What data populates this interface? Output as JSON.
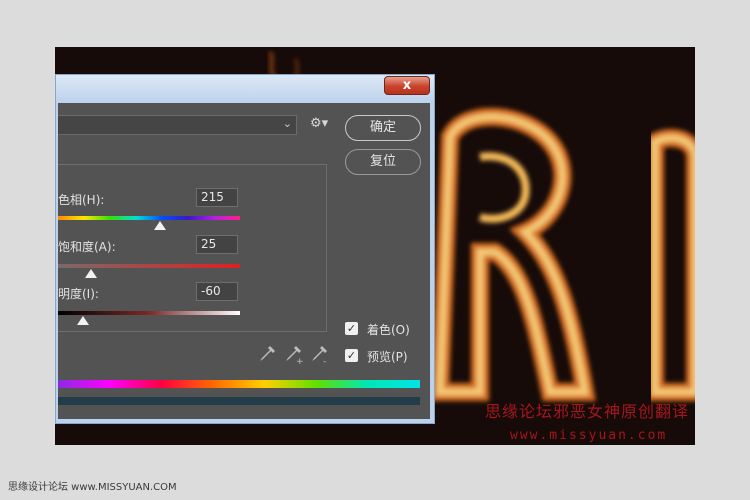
{
  "dialog": {
    "close_symbol": "x",
    "preset_chevron": "⌄",
    "gear_symbol": "⚙▾",
    "ok_label": "确定",
    "reset_label": "复位"
  },
  "hue": {
    "label": "色相(H):",
    "value": "215",
    "slider_fraction": 0.56
  },
  "saturation": {
    "label": "饱和度(A):",
    "value": "25",
    "slider_fraction": 0.18
  },
  "lightness": {
    "label": "明度(I):",
    "value": "-60",
    "slider_fraction": 0.14
  },
  "colorize": {
    "label": "着色(O)",
    "checked": true,
    "mark": "✓"
  },
  "preview": {
    "label": "预览(P)",
    "checked": true,
    "mark": "✓"
  },
  "eyedroppers": [
    "eyedropper-icon",
    "eyedropper-plus-icon",
    "eyedropper-minus-icon"
  ],
  "canvas": {
    "watermark_cn": "思缘论坛邪恶女神原创翻译",
    "watermark_url": "www.missyuan.com"
  },
  "footer": {
    "caption": "思缘设计论坛 www.MISSYUAN.COM"
  },
  "colors": {
    "dialog_bg": "#535353",
    "titlebar": "#c4d9ef",
    "close": "#c8432c",
    "watermark": "#a4161d"
  }
}
